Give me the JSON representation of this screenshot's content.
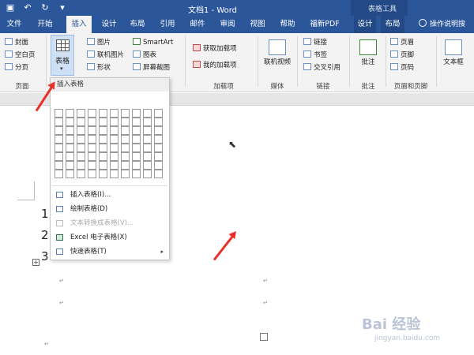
{
  "window": {
    "title": "文档1  -  Word",
    "context_title": "表格工具",
    "qat": {
      "save_icon": "save-icon",
      "undo_icon": "undo-icon",
      "redo_icon": "redo-icon",
      "customize_icon": "customize-qat-icon"
    }
  },
  "tabs": [
    {
      "label": "文件"
    },
    {
      "label": "开始"
    },
    {
      "label": "插入",
      "active": true
    },
    {
      "label": "设计"
    },
    {
      "label": "布局"
    },
    {
      "label": "引用"
    },
    {
      "label": "邮件"
    },
    {
      "label": "审阅"
    },
    {
      "label": "视图"
    },
    {
      "label": "帮助"
    },
    {
      "label": "福新PDF"
    },
    {
      "label": "设计"
    },
    {
      "label": "布局"
    }
  ],
  "tell_me": "操作说明搜",
  "ribbon": {
    "pages": {
      "items": [
        "封面",
        "空白页",
        "分页"
      ],
      "group": "页面"
    },
    "table": {
      "label": "表格",
      "caret": "▾"
    },
    "illustrations": {
      "items": [
        "图片",
        "联机图片",
        "形状"
      ],
      "items2": [
        "SmartArt",
        "图表",
        "屏幕截图"
      ]
    },
    "addins": {
      "items": [
        "获取加载项",
        "我的加载项"
      ],
      "group": "加载项"
    },
    "media": {
      "label": "联机视频",
      "group": "媒体"
    },
    "links": {
      "items": [
        "链接",
        "书签",
        "交叉引用"
      ],
      "group": "链接"
    },
    "comments": {
      "label": "批注",
      "group": "批注"
    },
    "header_footer": {
      "items": [
        "页眉",
        "页脚",
        "页码"
      ],
      "group": "页眉和页脚"
    },
    "text": {
      "label": "文本框"
    }
  },
  "dropdown": {
    "header": "插入表格",
    "grid": {
      "cols": 10,
      "rows": 8
    },
    "items": [
      {
        "label": "插入表格(I)...",
        "disabled": false,
        "icon": "insert-table-icon"
      },
      {
        "label": "绘制表格(D)",
        "disabled": false,
        "icon": "draw-table-icon"
      },
      {
        "label": "文本转换成表格(V)...",
        "disabled": true,
        "icon": "text-to-table-icon"
      },
      {
        "label": "Excel 电子表格(X)",
        "disabled": false,
        "icon": "excel-icon"
      },
      {
        "label": "快速表格(T)",
        "disabled": false,
        "icon": "quick-tables-icon",
        "submenu": true
      }
    ],
    "submenu_arrow": "▸"
  },
  "document": {
    "numbers": [
      "1",
      "2",
      "3"
    ],
    "mark": "↵"
  },
  "watermark": {
    "text": "Bai 经验",
    "url": "jingyan.baidu.com"
  }
}
